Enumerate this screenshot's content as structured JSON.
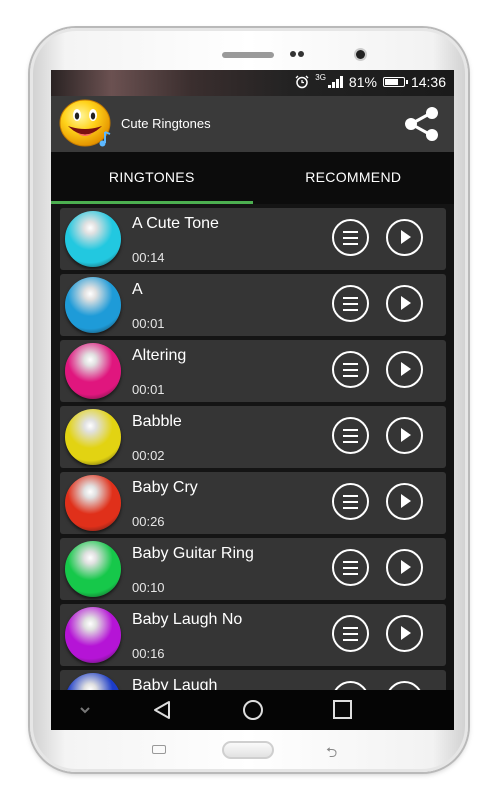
{
  "status_bar": {
    "network": "3G",
    "battery": "81%",
    "battery_level": 0.81,
    "time": "14:36"
  },
  "app_bar": {
    "title": "Cute Ringtones",
    "app_icon": "smiley-face-icon",
    "share_icon": "share-icon"
  },
  "tabs": [
    {
      "label": "RINGTONES",
      "active": true
    },
    {
      "label": "RECOMMEND",
      "active": false
    }
  ],
  "ringtones": [
    {
      "title": "A Cute Tone",
      "duration": "00:14",
      "color": "#22c8e0"
    },
    {
      "title": "A",
      "duration": "00:01",
      "color": "#1e9bd8"
    },
    {
      "title": "Altering",
      "duration": "00:01",
      "color": "#e0167e"
    },
    {
      "title": "Babble",
      "duration": "00:02",
      "color": "#e2d312"
    },
    {
      "title": "Baby Cry",
      "duration": "00:26",
      "color": "#e0301a"
    },
    {
      "title": "Baby Guitar Ring",
      "duration": "00:10",
      "color": "#16c84a"
    },
    {
      "title": "Baby Laugh No",
      "duration": "00:16",
      "color": "#b514d6"
    },
    {
      "title": "Baby Laugh",
      "duration": "",
      "color": "#1c3cc8"
    }
  ],
  "row_icons": {
    "menu": "hamburger-menu-icon",
    "play": "play-icon"
  },
  "nav_icons": [
    "chevron-down-icon",
    "back-triangle-icon",
    "home-circle-icon",
    "recents-square-icon"
  ]
}
